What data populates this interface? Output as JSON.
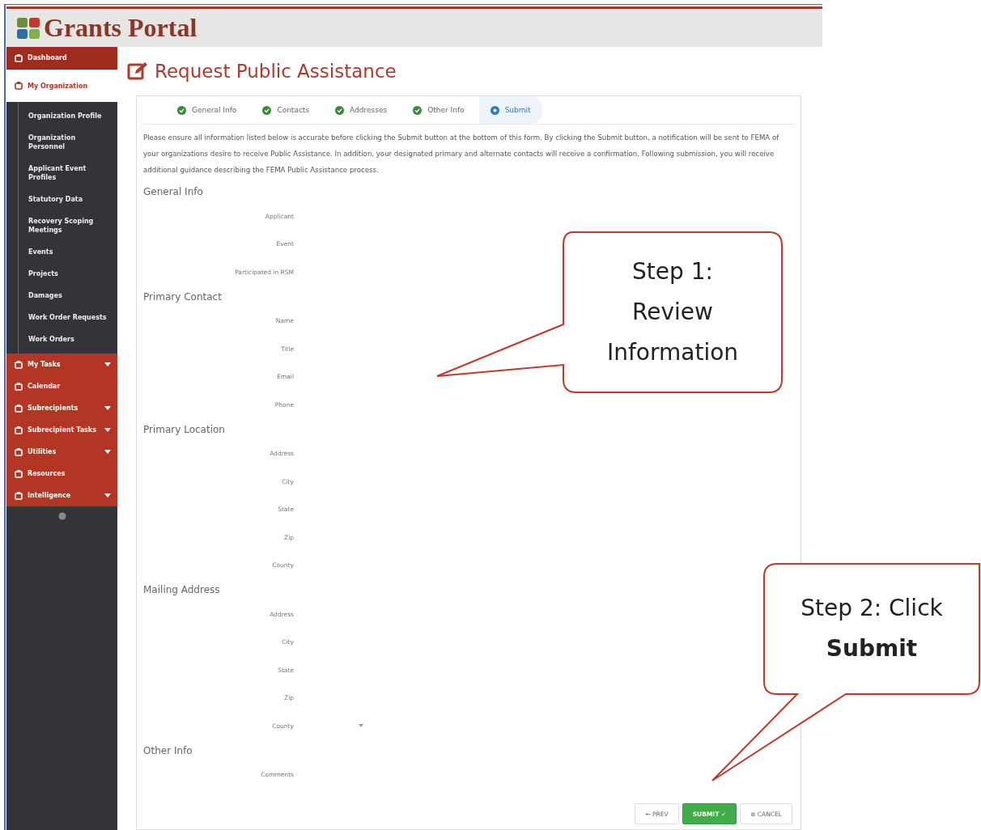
{
  "header": {
    "title": "Grants Portal"
  },
  "sidebar": {
    "items": [
      {
        "label": "Dashboard",
        "kind": "link",
        "selected": true
      },
      {
        "label": "My Organization",
        "kind": "group",
        "selected": false,
        "expanded": true,
        "children": [
          {
            "label": "Organization Profile"
          },
          {
            "label": "Organization Personnel"
          },
          {
            "label": "Applicant Event Profiles"
          },
          {
            "label": "Statutory Data"
          },
          {
            "label": "Recovery Scoping Meetings"
          },
          {
            "label": "Events"
          },
          {
            "label": "Projects"
          },
          {
            "label": "Damages"
          },
          {
            "label": "Work Order Requests"
          },
          {
            "label": "Work Orders"
          }
        ]
      },
      {
        "label": "My Tasks",
        "kind": "menu",
        "selected": false,
        "expanded": false
      },
      {
        "label": "Calendar",
        "kind": "link",
        "selected": false
      },
      {
        "label": "Subrecipients",
        "kind": "menu",
        "selected": false,
        "expanded": false
      },
      {
        "label": "Subrecipient Tasks",
        "kind": "menu",
        "selected": false,
        "expanded": false
      },
      {
        "label": "Utilities",
        "kind": "menu",
        "selected": false,
        "expanded": false
      },
      {
        "label": "Resources",
        "kind": "link",
        "selected": false
      },
      {
        "label": "Intelligence",
        "kind": "menu",
        "selected": false,
        "expanded": false
      }
    ]
  },
  "page": {
    "title": "Request Public Assistance"
  },
  "steps": [
    {
      "label": "General Info",
      "done": true,
      "selected": false
    },
    {
      "label": "Contacts",
      "done": true,
      "selected": false
    },
    {
      "label": "Addresses",
      "done": true,
      "selected": false
    },
    {
      "label": "Other Info",
      "done": true,
      "selected": false
    },
    {
      "label": "Submit",
      "done": false,
      "selected": true
    }
  ],
  "intro": "Please ensure all information listed below is accurate before clicking the Submit button at the bottom of this form. By clicking the Submit button, a notification will be sent to FEMA of your organizations desire to receive Public Assistance. In addition, your designated primary and alternate contacts will receive a confirmation. Following submission, you will receive additional guidance describing the FEMA Public Assistance process.",
  "sections": [
    {
      "title": "General Info",
      "fields": [
        {
          "label": "Applicant",
          "kind": "text"
        },
        {
          "label": "Event",
          "kind": "text"
        },
        {
          "label": "Participated in RSM",
          "kind": "text"
        }
      ]
    },
    {
      "title": "Primary Contact",
      "fields": [
        {
          "label": "Name",
          "kind": "text"
        },
        {
          "label": "Title",
          "kind": "text"
        },
        {
          "label": "Email",
          "kind": "text"
        },
        {
          "label": "Phone",
          "kind": "text"
        }
      ]
    },
    {
      "title": "Primary Location",
      "fields": [
        {
          "label": "Address",
          "kind": "text"
        },
        {
          "label": "City",
          "kind": "text"
        },
        {
          "label": "State",
          "kind": "text"
        },
        {
          "label": "Zip",
          "kind": "text"
        },
        {
          "label": "County",
          "kind": "text"
        }
      ]
    },
    {
      "title": "Mailing Address",
      "fields": [
        {
          "label": "Address",
          "kind": "text"
        },
        {
          "label": "City",
          "kind": "text"
        },
        {
          "label": "State",
          "kind": "text"
        },
        {
          "label": "Zip",
          "kind": "text"
        },
        {
          "label": "County",
          "kind": "select"
        }
      ]
    },
    {
      "title": "Other Info",
      "fields": [
        {
          "label": "Comments",
          "kind": "text"
        }
      ]
    }
  ],
  "buttons": [
    {
      "label": "← PREV",
      "kind": "default"
    },
    {
      "label": "SUBMIT ✓",
      "kind": "primary"
    },
    {
      "label": "⊗ CANCEL",
      "kind": "default"
    }
  ],
  "callouts": [
    {
      "text": "Step 1: Review Information"
    },
    {
      "text": "Step 2: Click **Submit**"
    }
  ]
}
